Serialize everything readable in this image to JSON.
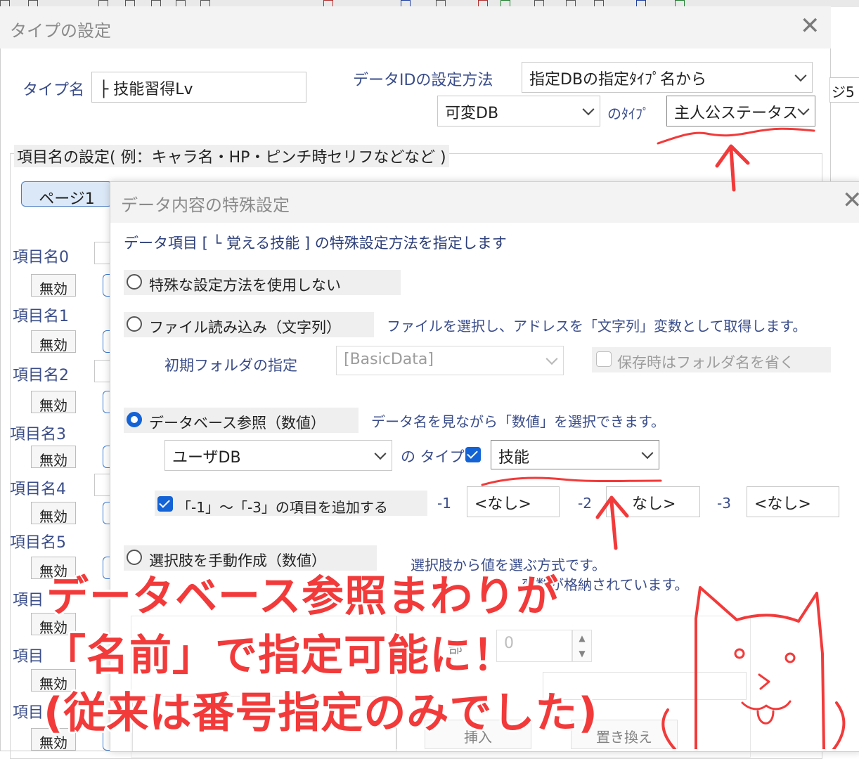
{
  "type_dialog": {
    "title": "タイプの設定",
    "type_name_label": "タイプ名",
    "type_name_value": "├ 技能習得Lv",
    "data_id_method_label": "データIDの設定方法",
    "data_id_method_value": "指定DBの指定ﾀｲﾌﾟ名から",
    "db_select_value": "可変DB",
    "no_type_label": "のﾀｲﾌﾟ",
    "type_select_value": "主人公ステータス",
    "right_tab_fragment": "ジ5",
    "item_names_group_label": "項目名の設定( 例：キャラ名・HP・ピンチ時セリフなどなど )",
    "page1_label": "ページ1",
    "item_labels": [
      "項目名0",
      "項目名1",
      "項目名2",
      "項目名3",
      "項目名4",
      "項目名5",
      "項目",
      "項目",
      "項目"
    ],
    "disable_label": "無効",
    "insert_button": "挿入",
    "replace_button": "置き換え"
  },
  "special_dialog": {
    "title": "データ内容の特殊設定",
    "instruction": "データ項目 [ └ 覚える技能 ] の特殊設定方法を指定します",
    "opt_none": "特殊な設定方法を使用しない",
    "opt_file": "ファイル読み込み（文字列）",
    "opt_file_desc": "ファイルを選択し、アドレスを「文字列」変数として取得します。",
    "initial_folder_label": "初期フォルダの指定",
    "initial_folder_value": "[BasicData]",
    "omit_folder_label": "保存時はフォルダ名を省く",
    "opt_db": "データベース参照（数値）",
    "opt_db_desc": "データ名を見ながら「数値」を選択できます。",
    "db_value": "ユーザDB",
    "db_type_label": "の タイプ",
    "db_type_value": "技能",
    "add_items_label": "「-1」～「-3」の項目を追加する",
    "minus1_label": "-1",
    "minus1_value": "<なし>",
    "minus2_label": "-2",
    "minus2_value": "なし>",
    "minus3_label": "-3",
    "minus3_value": "<なし>",
    "opt_manual": "選択肢を手動作成（数値）",
    "opt_manual_desc1": "選択肢から値を選ぶ方式です。",
    "opt_manual_desc2": "変数が格納されています。",
    "partial_label": "部",
    "spin_value": "0"
  },
  "caption": {
    "line1": "データベース参照まわりが",
    "line2": "「名前」で指定可能に！",
    "line3": "(従来は番号指定のみでした)"
  },
  "colors": {
    "accent_blue": "#1463d6",
    "label_blue": "#3a4d8a",
    "annotation_red": "#f23a3a"
  }
}
